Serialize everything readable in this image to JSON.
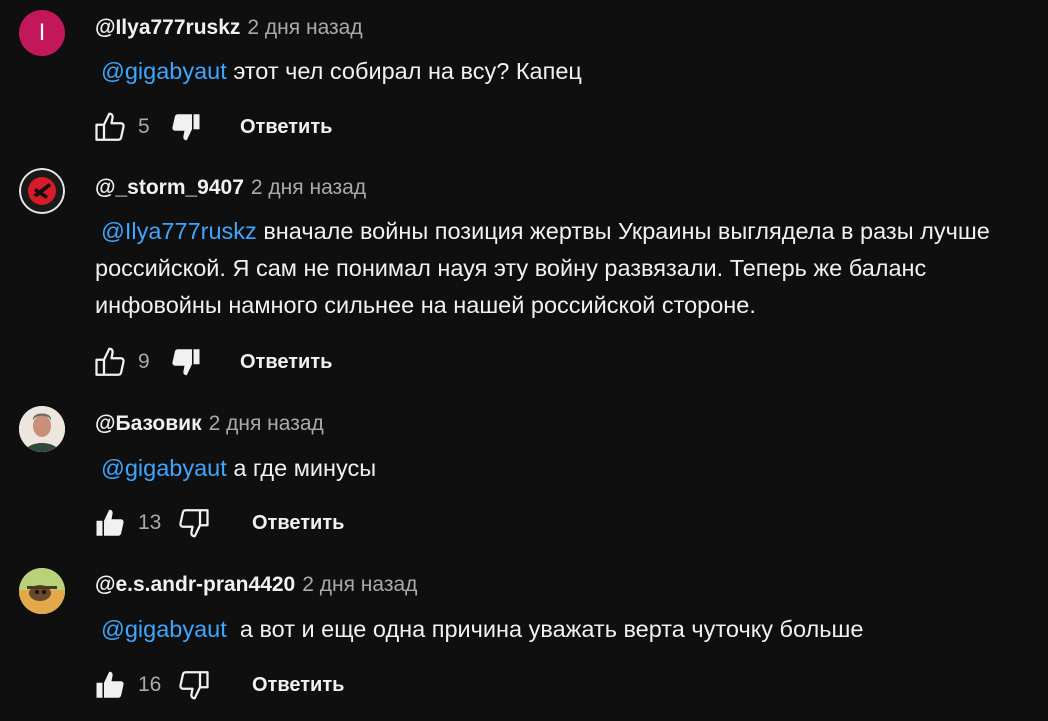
{
  "comments": [
    {
      "avatar_letter": "I",
      "author": "@Ilya777ruskz",
      "time": "2 дня назад",
      "mention": "@gigabyaut",
      "text": "этот чел собирал на всу? Капец",
      "likes": "5",
      "liked": false,
      "disliked": true,
      "reply_label": "Ответить"
    },
    {
      "author": "@_storm_9407",
      "time": "2 дня назад",
      "mention": "@Ilya777ruskz",
      "text": "вначале войны позиция жертвы Украины выглядела в разы лучше российской. Я сам не понимал науя эту войну развязали. Теперь же баланс инфовойны намного сильнее на нашей российской стороне.",
      "likes": "9",
      "liked": false,
      "disliked": true,
      "reply_label": "Ответить"
    },
    {
      "author": "@Базовик",
      "time": "2 дня назад",
      "mention": "@gigabyaut",
      "text": "а где минусы",
      "likes": "13",
      "liked": true,
      "disliked": false,
      "reply_label": "Ответить"
    },
    {
      "author": "@e.s.andr-pran4420",
      "time": "2 дня назад",
      "mention": "@gigabyaut",
      "text": " а вот и еще одна причина уважать верта чуточку больше",
      "likes": "16",
      "liked": true,
      "disliked": false,
      "reply_label": "Ответить"
    }
  ],
  "colors": {
    "background": "#0f0f0f",
    "mention": "#3ea6ff",
    "meta": "#aaaaaa",
    "avatar_letter_bg": "#c2185b"
  }
}
